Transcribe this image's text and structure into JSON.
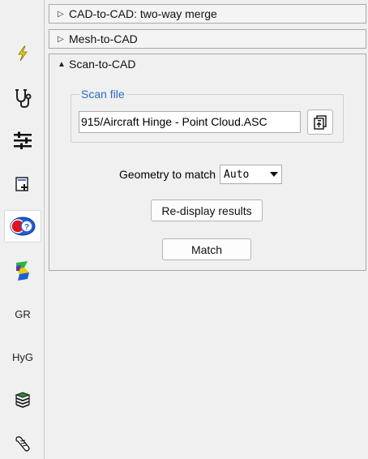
{
  "toolbar": {
    "items": [
      {
        "icon": "lightning-icon"
      },
      {
        "icon": "stethoscope-icon"
      },
      {
        "icon": "sliders-icon"
      },
      {
        "icon": "add-layer-icon"
      },
      {
        "icon": "scan-match-icon",
        "active": true
      },
      {
        "icon": "surface-layers-icon"
      },
      {
        "icon": "text",
        "label": "GR"
      },
      {
        "icon": "text",
        "label": "HyG"
      },
      {
        "icon": "stack-icon"
      },
      {
        "icon": "scroll-icon"
      }
    ]
  },
  "sections": {
    "cad_to_cad": {
      "label": "CAD-to-CAD: two-way merge",
      "expanded": false
    },
    "mesh_to_cad": {
      "label": "Mesh-to-CAD",
      "expanded": false
    },
    "scan_to_cad": {
      "label": "Scan-to-CAD",
      "expanded": true
    }
  },
  "scan": {
    "group_title": "Scan file",
    "file_path": "915/Aircraft Hinge - Point Cloud.ASC",
    "geometry_label": "Geometry to match",
    "geometry_value": "Auto",
    "redisplay_label": "Re-display results",
    "match_label": "Match"
  },
  "colors": {
    "accent": "#2a6cc4",
    "active_icon_red": "#e0131a",
    "active_icon_blue": "#1f5fd6"
  }
}
